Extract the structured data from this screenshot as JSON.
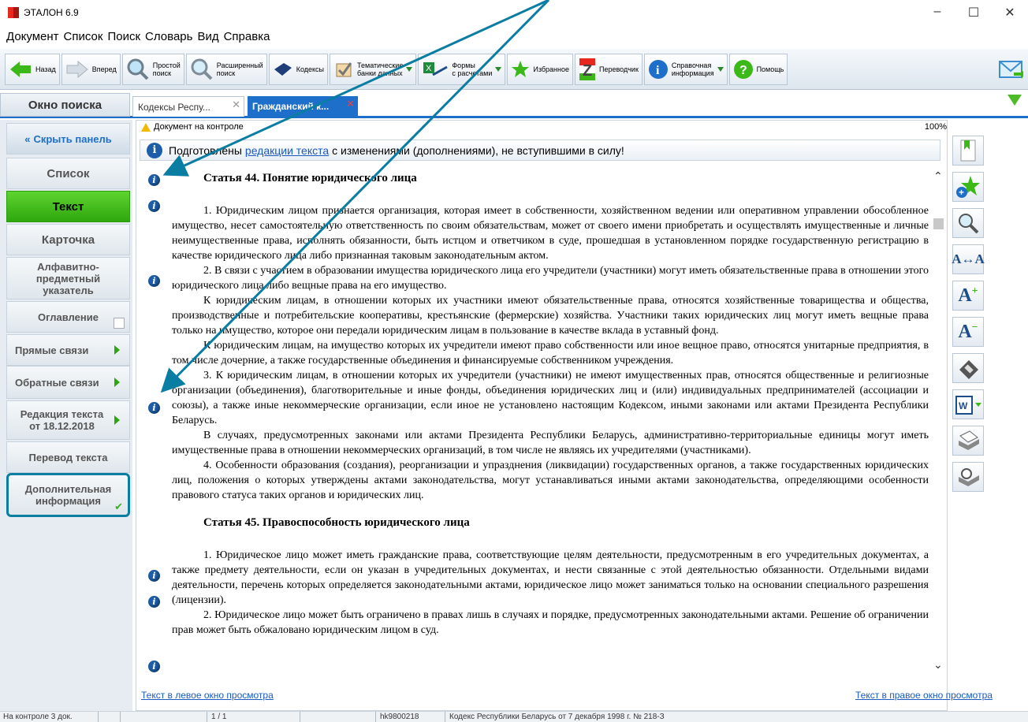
{
  "window": {
    "title": "ЭТАЛОН 6.9",
    "controls": [
      "–",
      "☐",
      "✕"
    ]
  },
  "menu": [
    "Документ",
    "Список",
    "Поиск",
    "Словарь",
    "Вид",
    "Справка"
  ],
  "toolbar": {
    "back": "Назад",
    "forward": "Вперед",
    "simple_search": [
      "Простой",
      "поиск"
    ],
    "ext_search": [
      "Расширенный",
      "поиск"
    ],
    "codes": "Кодексы",
    "thematic": [
      "Тематические",
      "банки данных"
    ],
    "forms": [
      "Формы",
      "с расчетами"
    ],
    "favorites": "Избранное",
    "translator": "Переводчик",
    "reference": [
      "Справочная",
      "информация"
    ],
    "help": "Помощь"
  },
  "tabs": {
    "search_window": "Окно поиска",
    "tab1": "Кодексы Респу...",
    "tab2": "Гражданский к..."
  },
  "sidebar": {
    "hide_panel": "Скрыть панель",
    "list": "Список",
    "text": "Текст",
    "card": "Карточка",
    "alphabet": "Алфавитно-предметный указатель",
    "toc": "Оглавление",
    "direct_links": "Прямые связи",
    "back_links": "Обратные связи",
    "edition": "Редакция текста от 18.12.2018",
    "translation": "Перевод текста",
    "additional": "Дополнительная информация"
  },
  "document": {
    "status": "Документ на контроле",
    "zoom": "100%",
    "banner_prefix": "Подготовлены",
    "banner_link": "редакции текста",
    "banner_suffix": "с изменениями (дополнениями), не вступившими в силу!",
    "article44_title": "Статья 44. Понятие юридического лица",
    "p1": "1. Юридическим лицом признается организация, которая имеет в собственности, хозяйственном ведении или оперативном управлении обособленное имущество, несет самостоятельную ответственность по своим обязательствам, может от своего имени приобретать и осуществлять имущественные и личные неимущественные права, исполнять обязанности, быть истцом и ответчиком в суде, прошедшая в установленном порядке государственную регистрацию в качестве юридического лица либо признанная таковым законодательным актом.",
    "p2": "2. В связи с участием в образовании имущества юридического лица его учредители (участники) могут иметь обязательственные права в отношении этого юридического лица либо вещные права на его имущество.",
    "p3": "К юридическим лицам, в отношении которых их участники имеют обязательственные права, относятся хозяйственные товарищества и общества, производственные и потребительские кооперативы, крестьянские (фермерские) хозяйства. Участники таких юридических лиц могут иметь вещные права только на имущество, которое они передали юридическим лицам в пользование в качестве вклада в уставный фонд.",
    "p4": "К юридическим лицам, на имущество которых их учредители имеют право собственности или иное вещное право, относятся унитарные предприятия, в том числе дочерние, а также государственные объединения и финансируемые собственником учреждения.",
    "p5": "3. К юридическим лицам, в отношении которых их учредители (участники) не имеют имущественных прав, относятся общественные и религиозные организации (объединения), благотворительные и иные фонды, объединения юридических лиц и (или) индивидуальных предпринимателей (ассоциации и союзы), а также иные некоммерческие организации, если иное не установлено настоящим Кодексом, иными законами или актами Президента Республики Беларусь.",
    "p6": "В случаях, предусмотренных законами или актами Президента Республики Беларусь, административно-территориальные единицы могут иметь имущественные права в отношении некоммерческих организаций, в том числе не являясь их учредителями (участниками).",
    "p7": "4. Особенности образования (создания), реорганизации и упразднения (ликвидации) государственных органов, а также государственных юридических лиц, положения о которых утверждены актами законодательства, могут устанавливаться иными актами законодательства, определяющими особенности правового статуса таких органов и юридических лиц.",
    "article45_title": "Статья 45. Правоспособность юридического лица",
    "p8": "1. Юридическое лицо может иметь гражданские права, соответствующие целям деятельности, предусмотренным в его учредительных документах, а также предмету деятельности, если он указан в учредительных документах, и нести связанные с этой деятельностью обязанности. Отдельными видами деятельности, перечень которых определяется законодательными актами, юридическое лицо может заниматься только на основании специального разрешения (лицензии).",
    "p9": "2. Юридическое лицо может быть ограничено в правах лишь в случаях и порядке, предусмотренных законодательными актами. Решение об ограничении прав может быть обжаловано юридическим лицом в суд.",
    "link_left": "Текст в левое окно просмотра",
    "link_right": "Текст в правое окно просмотра"
  },
  "statusbar": {
    "control": "На контроле 3 док.",
    "pages": "1 / 1",
    "doc_id": "hk9800218",
    "doc_name": "Кодекс Республики Беларусь от 7 декабря 1998 г. № 218-З"
  },
  "colors": {
    "accent": "#1e6fc9",
    "active_green": "#3cb818",
    "annotation": "#0a7da3"
  }
}
